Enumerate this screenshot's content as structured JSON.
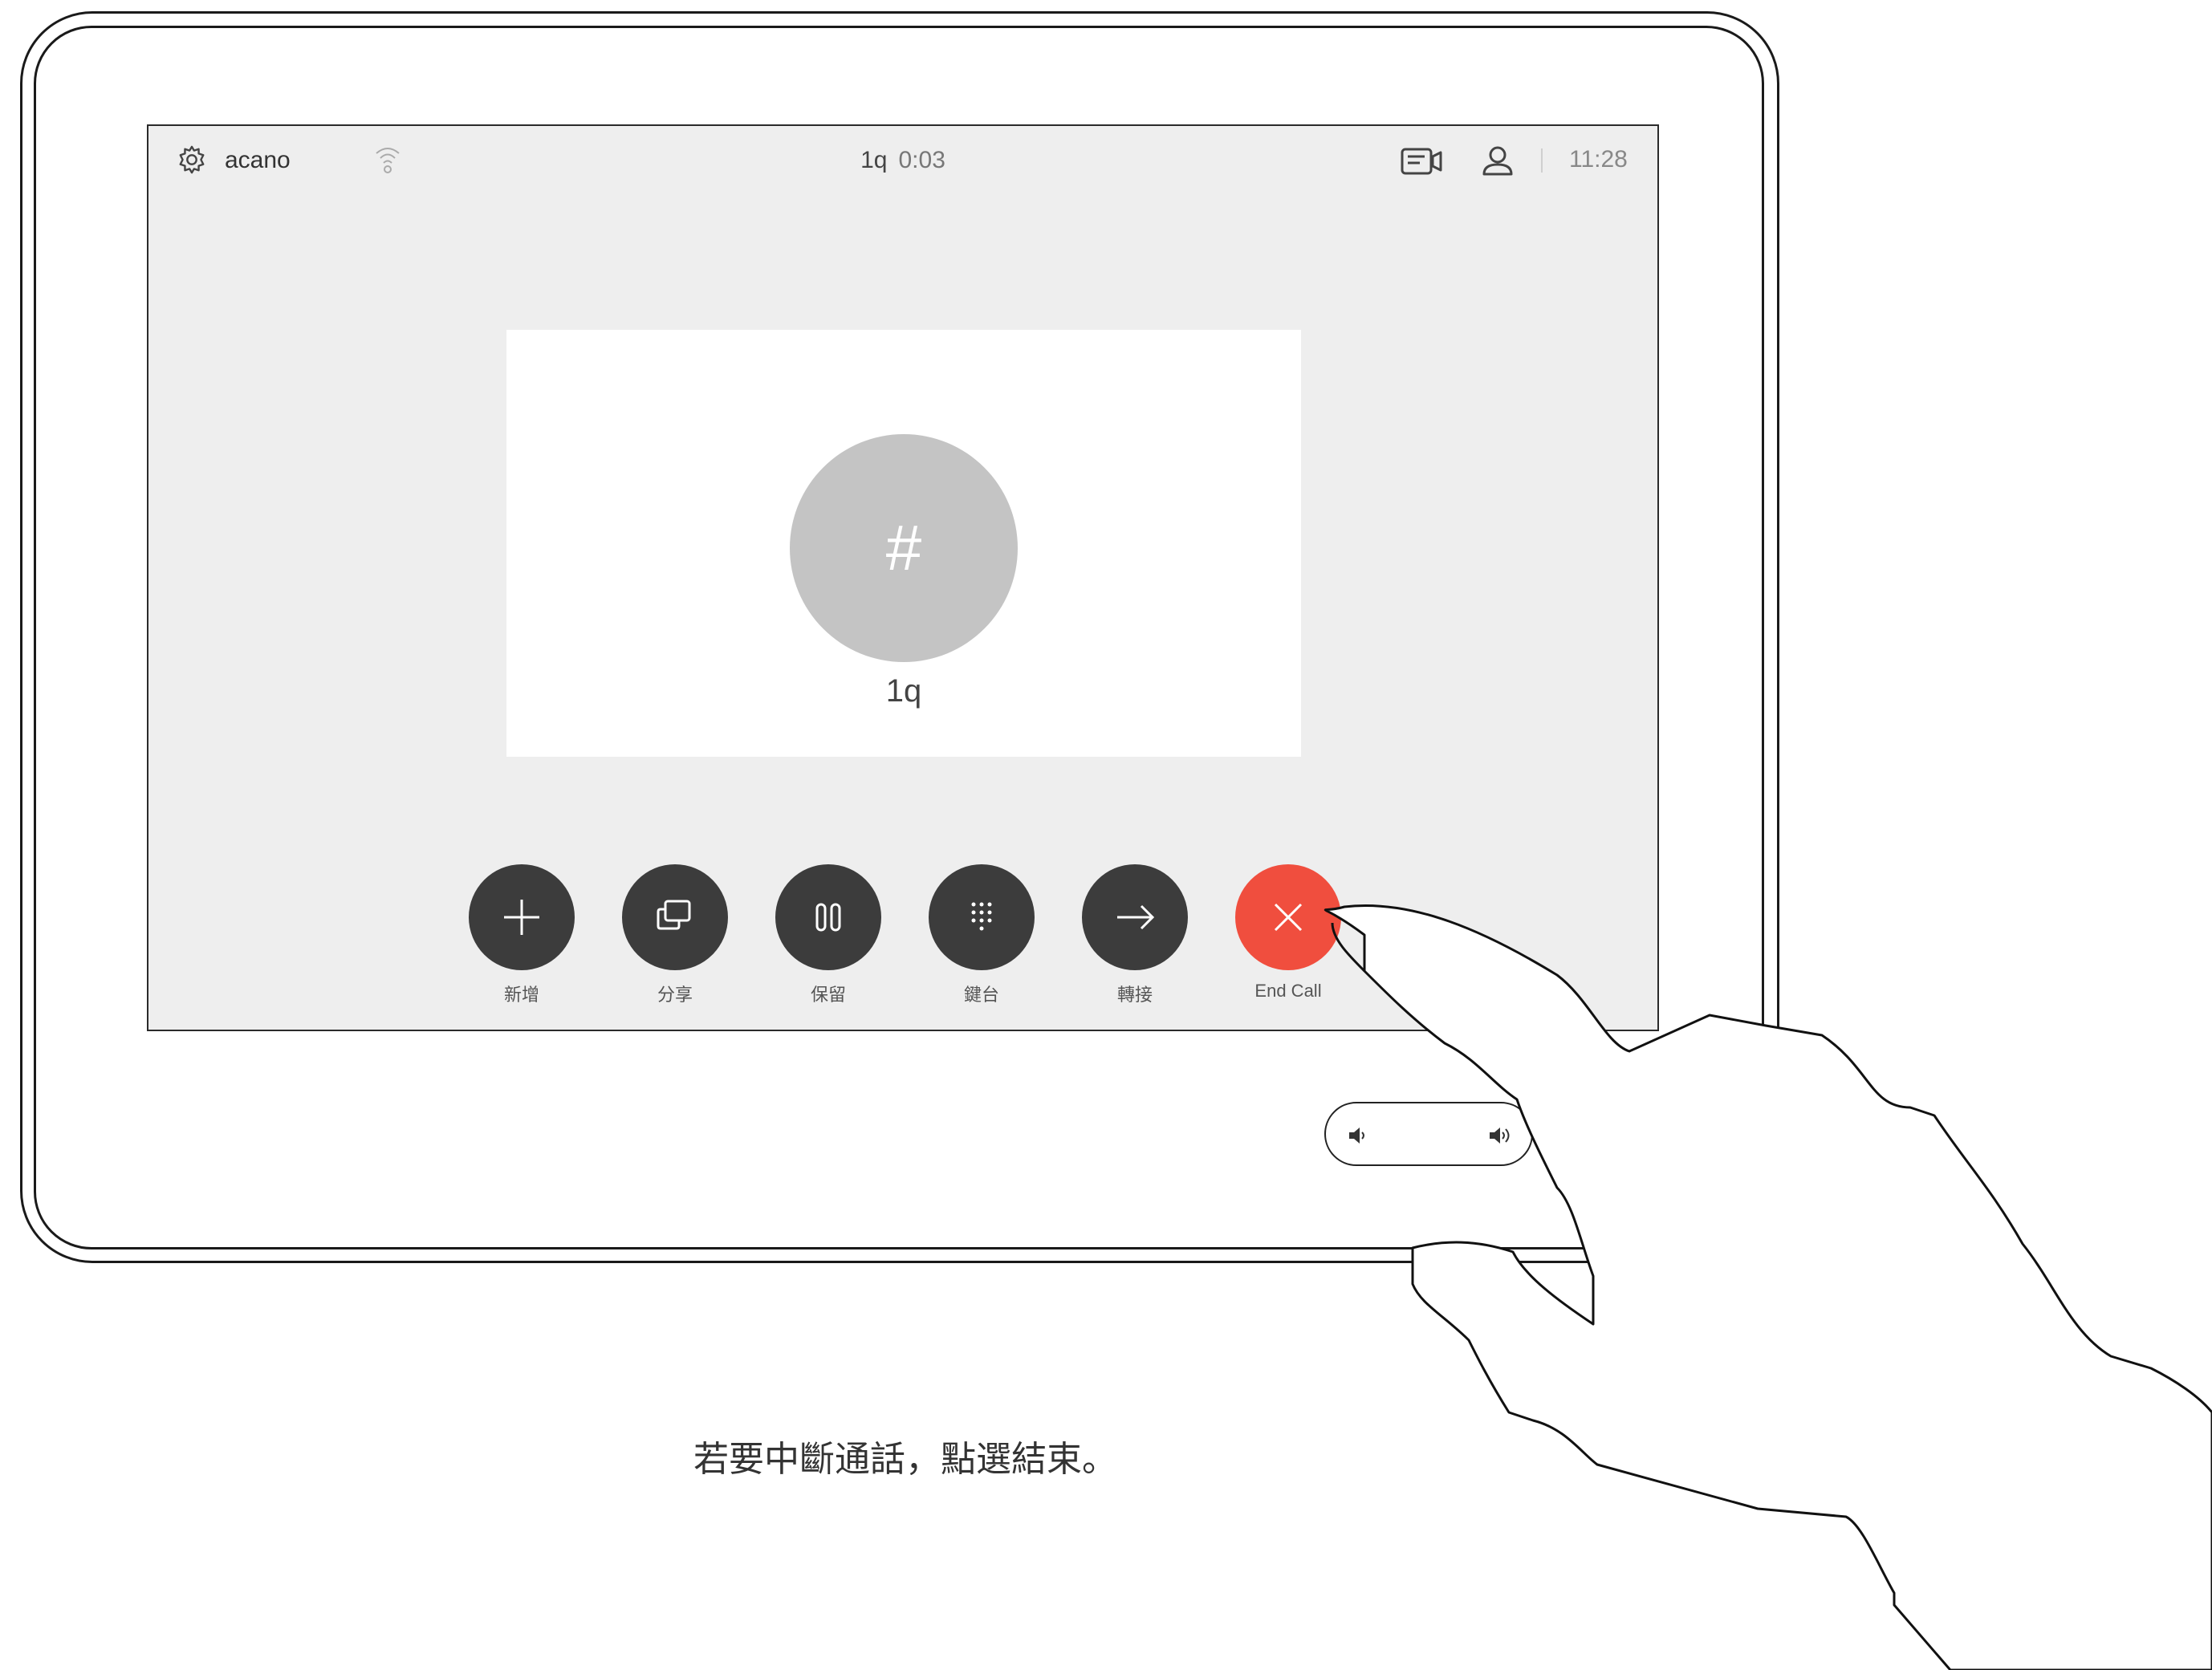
{
  "status_bar": {
    "system_name": "acano",
    "call_name": "1q",
    "call_duration": "0:03",
    "clock": "11:28"
  },
  "participant": {
    "avatar_symbol": "#",
    "name": "1q"
  },
  "controls": [
    {
      "label": "新增",
      "icon": "plus-icon"
    },
    {
      "label": "分享",
      "icon": "share-icon"
    },
    {
      "label": "保留",
      "icon": "hold-icon"
    },
    {
      "label": "鍵台",
      "icon": "keypad-icon"
    },
    {
      "label": "轉接",
      "icon": "transfer-icon"
    },
    {
      "label": "End Call",
      "icon": "close-icon"
    }
  ],
  "caption": "若要中斷通話，點選結束。",
  "colors": {
    "screen_bg": "#eeeeee",
    "button_dark": "#3c3c3c",
    "end_call_red": "#f04e3e",
    "avatar_grey": "#c4c4c4"
  }
}
